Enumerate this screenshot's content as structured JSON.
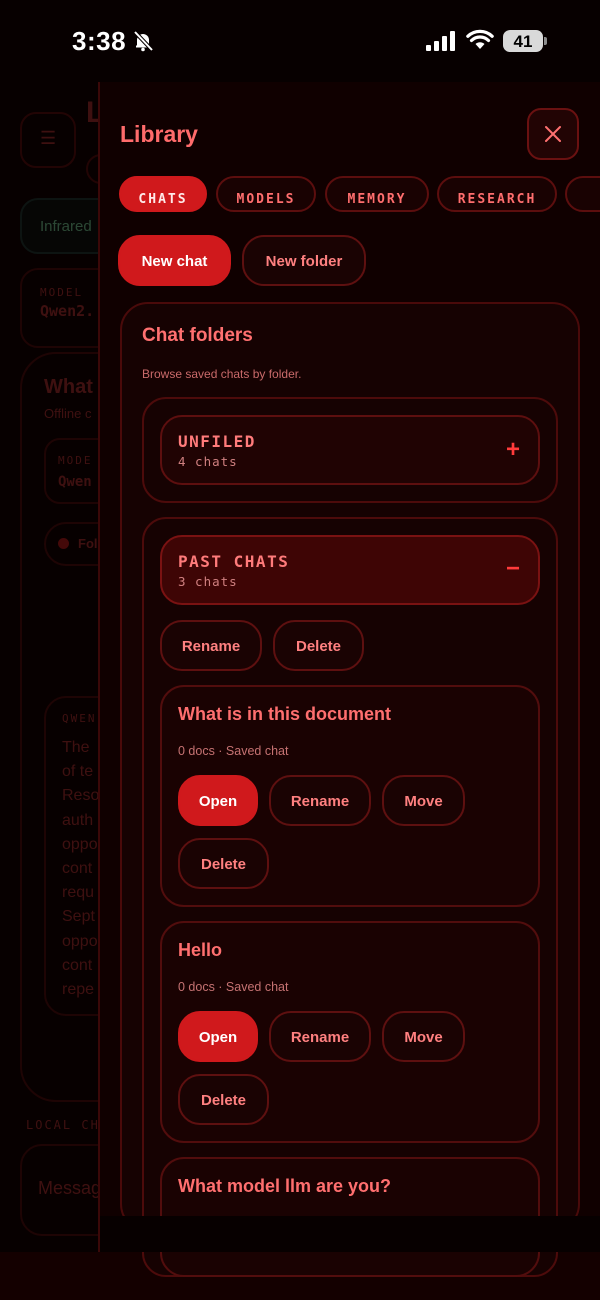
{
  "status_bar": {
    "time": "3:38",
    "battery": "41"
  },
  "background_app": {
    "menu_icon": "hamburger-icon",
    "title_partial": "L",
    "status_partial": "Infrared",
    "model_caption": "MODEL",
    "model_value_partial": "Qwen2.",
    "card_title_partial": "What",
    "card_sub_partial": "Offline c",
    "inner_caption_partial": "MODE",
    "inner_value_partial": "Qwen",
    "chip_partial": "Fol",
    "reply_caption_partial": "QWEN",
    "reply_lines_partial": "The\nof te\nReso\nauth\noppo\ncont\nrequ\nSept\noppo\ncont\nrepe",
    "local_caption_partial": "LOCAL CH",
    "input_placeholder_partial": "Messag"
  },
  "library": {
    "title": "Library",
    "close_icon": "close-icon",
    "tabs": [
      {
        "label": "CHATS",
        "active": true
      },
      {
        "label": "MODELS",
        "active": false
      },
      {
        "label": "MEMORY",
        "active": false
      },
      {
        "label": "RESEARCH",
        "active": false
      },
      {
        "label": "",
        "active": false
      }
    ],
    "new_chat_label": "New chat",
    "new_folder_label": "New folder",
    "panel": {
      "title": "Chat folders",
      "subtitle": "Browse saved chats by folder.",
      "folders": [
        {
          "name": "UNFILED",
          "count": "4 chats",
          "toggle": "+",
          "expanded": false
        },
        {
          "name": "PAST CHATS",
          "count": "3 chats",
          "toggle": "−",
          "expanded": true,
          "rename_label": "Rename",
          "delete_label": "Delete"
        }
      ],
      "chats": [
        {
          "title": "What is in this document",
          "meta": "0 docs · Saved chat",
          "open": "Open",
          "rename": "Rename",
          "move": "Move",
          "delete": "Delete"
        },
        {
          "title": "Hello",
          "meta": "0 docs · Saved chat",
          "open": "Open",
          "rename": "Rename",
          "move": "Move",
          "delete": "Delete"
        },
        {
          "title": "What model llm are you?"
        }
      ]
    }
  },
  "colors": {
    "accent": "#d0191c",
    "text_accent": "#ff6b6b",
    "background": "#070000",
    "panel": "#160202"
  }
}
